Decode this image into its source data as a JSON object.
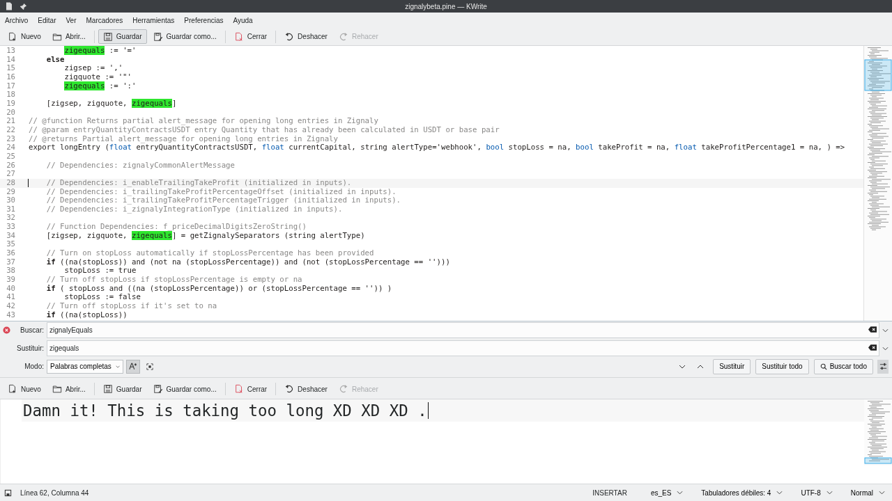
{
  "window": {
    "title": "zignalybeta.pine — KWrite"
  },
  "menu": [
    "Archivo",
    "Editar",
    "Ver",
    "Marcadores",
    "Herramientas",
    "Preferencias",
    "Ayuda"
  ],
  "toolbar": [
    {
      "kind": "new",
      "label": "Nuevo",
      "disabled": false,
      "hovered": false
    },
    {
      "kind": "open",
      "label": "Abrir...",
      "disabled": false,
      "hovered": false
    },
    {
      "kind": "save",
      "label": "Guardar",
      "disabled": false,
      "hovered": true
    },
    {
      "kind": "saveas",
      "label": "Guardar como...",
      "disabled": false,
      "hovered": false
    },
    {
      "kind": "close",
      "label": "Cerrar",
      "disabled": false,
      "hovered": false
    },
    {
      "kind": "undo",
      "label": "Deshacer",
      "disabled": false,
      "hovered": false
    },
    {
      "kind": "redo",
      "label": "Rehacer",
      "disabled": true,
      "hovered": false
    }
  ],
  "editor": {
    "lines": [
      {
        "number": "13",
        "current": false,
        "kind": "nested",
        "segments": [
          {
            "kind": "match",
            "text": "zigequals"
          },
          {
            "kind": "plain",
            "text": " := '='"
          }
        ]
      },
      {
        "number": "14",
        "current": false,
        "kind": "body",
        "segments": [
          {
            "kind": "keyword",
            "text": "else"
          }
        ]
      },
      {
        "number": "15",
        "current": false,
        "kind": "nested",
        "segments": [
          {
            "kind": "plain",
            "text": "zigsep := ','"
          }
        ]
      },
      {
        "number": "16",
        "current": false,
        "kind": "nested",
        "segments": [
          {
            "kind": "plain",
            "text": "zigquote := '\"'"
          }
        ]
      },
      {
        "number": "17",
        "current": false,
        "kind": "nested",
        "segments": [
          {
            "kind": "match",
            "text": "zigequals"
          },
          {
            "kind": "plain",
            "text": " := ':'"
          }
        ]
      },
      {
        "number": "18",
        "current": false,
        "kind": "blank"
      },
      {
        "number": "19",
        "current": false,
        "kind": "body",
        "segments": [
          {
            "kind": "plain",
            "text": "[zigsep, zigquote, "
          },
          {
            "kind": "match",
            "text": "zigequals"
          },
          {
            "kind": "plain",
            "text": "]"
          }
        ]
      },
      {
        "number": "20",
        "current": false,
        "kind": "blank"
      },
      {
        "number": "21",
        "current": false,
        "kind": "top",
        "segments": [
          {
            "kind": "comment",
            "text": "// @function Returns partial alert_message for opening long entries in Zignaly"
          }
        ]
      },
      {
        "number": "22",
        "current": false,
        "kind": "top",
        "segments": [
          {
            "kind": "comment",
            "text": "// @param entryQuantityContractsUSDT entry Quantity that has already been calculated in USDT or base pair"
          }
        ]
      },
      {
        "number": "23",
        "current": false,
        "kind": "top",
        "segments": [
          {
            "kind": "comment",
            "text": "// @returns Partial alert_message for opening long entries in Zignaly"
          }
        ]
      },
      {
        "number": "24",
        "current": false,
        "kind": "top",
        "segments": [
          {
            "kind": "plain",
            "text": "export longEntry ("
          },
          {
            "kind": "type",
            "text": "float"
          },
          {
            "kind": "plain",
            "text": " entryQuantityContractsUSDT, "
          },
          {
            "kind": "type",
            "text": "float"
          },
          {
            "kind": "plain",
            "text": " currentCapital, string alertType='webhook', "
          },
          {
            "kind": "type",
            "text": "bool"
          },
          {
            "kind": "plain",
            "text": " stopLoss = na, "
          },
          {
            "kind": "type",
            "text": "bool"
          },
          {
            "kind": "plain",
            "text": " takeProfit = na, "
          },
          {
            "kind": "type",
            "text": "float"
          },
          {
            "kind": "plain",
            "text": " takeProfitPercentage1 = na, ) =>"
          }
        ]
      },
      {
        "number": "25",
        "current": false,
        "kind": "blank"
      },
      {
        "number": "26",
        "current": false,
        "kind": "body",
        "segments": [
          {
            "kind": "comment",
            "text": "// Dependencies: zignalyCommonAlertMessage"
          }
        ]
      },
      {
        "number": "27",
        "current": false,
        "kind": "blank"
      },
      {
        "number": "28",
        "current": true,
        "kind": "body",
        "segments": [
          {
            "kind": "comment",
            "text": "// Dependencies: i_enableTrailingTakeProfit (initialized in inputs)."
          }
        ]
      },
      {
        "number": "29",
        "current": false,
        "kind": "body",
        "segments": [
          {
            "kind": "comment",
            "text": "// Dependencies: i_trailingTakeProfitPercentageOffset (initialized in inputs)."
          }
        ]
      },
      {
        "number": "30",
        "current": false,
        "kind": "body",
        "segments": [
          {
            "kind": "comment",
            "text": "// Dependencies: i_trailingTakeProfitPercentageTrigger (initialized in inputs)."
          }
        ]
      },
      {
        "number": "31",
        "current": false,
        "kind": "body",
        "segments": [
          {
            "kind": "comment",
            "text": "// Dependencies: i_zignalyIntegrationType (initialized in inputs)."
          }
        ]
      },
      {
        "number": "32",
        "current": false,
        "kind": "blank"
      },
      {
        "number": "33",
        "current": false,
        "kind": "body",
        "segments": [
          {
            "kind": "comment",
            "text": "// Function Dependencies: f_priceDecimalDigitsZeroString()"
          }
        ]
      },
      {
        "number": "34",
        "current": false,
        "kind": "body",
        "segments": [
          {
            "kind": "plain",
            "text": "[zigsep, zigquote, "
          },
          {
            "kind": "match",
            "text": "zigequals"
          },
          {
            "kind": "plain",
            "text": "] = getZignalySeparators (string alertType)"
          }
        ]
      },
      {
        "number": "35",
        "current": false,
        "kind": "blank"
      },
      {
        "number": "36",
        "current": false,
        "kind": "body",
        "segments": [
          {
            "kind": "comment",
            "text": "// Turn on stopLoss automatically if stopLossPercentage has been provided"
          }
        ]
      },
      {
        "number": "37",
        "current": false,
        "kind": "body",
        "segments": [
          {
            "kind": "keyword",
            "text": "if"
          },
          {
            "kind": "plain",
            "text": " ((na(stopLoss)) and (not na (stopLossPercentage)) and (not (stopLossPercentage == '')))"
          }
        ]
      },
      {
        "number": "38",
        "current": false,
        "kind": "nested",
        "segments": [
          {
            "kind": "plain",
            "text": "stopLoss := true"
          }
        ]
      },
      {
        "number": "39",
        "current": false,
        "kind": "body",
        "segments": [
          {
            "kind": "comment",
            "text": "// Turn off stopLoss if stopLossPercentage is empty or na"
          }
        ]
      },
      {
        "number": "40",
        "current": false,
        "kind": "body",
        "segments": [
          {
            "kind": "keyword",
            "text": "if"
          },
          {
            "kind": "plain",
            "text": " ( stopLoss and ((na (stopLossPercentage)) or (stopLossPercentage == '')) )"
          }
        ]
      },
      {
        "number": "41",
        "current": false,
        "kind": "nested",
        "segments": [
          {
            "kind": "plain",
            "text": "stopLoss := false"
          }
        ]
      },
      {
        "number": "42",
        "current": false,
        "kind": "body",
        "segments": [
          {
            "kind": "comment",
            "text": "// Turn off stopLoss if it's set to na"
          }
        ]
      },
      {
        "number": "43",
        "current": false,
        "kind": "body",
        "segments": [
          {
            "kind": "keyword",
            "text": "if"
          },
          {
            "kind": "plain",
            "text": " ((na(stopLoss))"
          }
        ]
      }
    ]
  },
  "search_panel": {
    "search_label": "Buscar:",
    "search_value": "zignalyEquals",
    "replace_label": "Sustituir:",
    "replace_value": "zigequals",
    "mode_label": "Modo:",
    "mode_value": "Palabras completas",
    "options": [
      {
        "kind": "match-case",
        "selected": true
      },
      {
        "kind": "selection-only",
        "selected": false
      }
    ],
    "buttons": [
      "Sustituir",
      "Sustituir todo",
      "Buscar todo"
    ]
  },
  "second_window": {
    "toolbar": [
      {
        "kind": "new",
        "label": "Nuevo",
        "disabled": false,
        "hovered": false
      },
      {
        "kind": "open",
        "label": "Abrir...",
        "disabled": false,
        "hovered": false
      },
      {
        "kind": "save",
        "label": "Guardar",
        "disabled": false,
        "hovered": false
      },
      {
        "kind": "saveas",
        "label": "Guardar como...",
        "disabled": false,
        "hovered": false
      },
      {
        "kind": "close",
        "label": "Cerrar",
        "disabled": false,
        "hovered": false
      },
      {
        "kind": "undo",
        "label": "Deshacer",
        "disabled": false,
        "hovered": false
      },
      {
        "kind": "redo",
        "label": "Rehacer",
        "disabled": true,
        "hovered": false
      }
    ],
    "text": "Damn it! This is taking too long XD XD XD ."
  },
  "status_bar": {
    "position": "Línea 62, Columna 44",
    "mode": "INSERTAR",
    "dropdowns": [
      "es_ES",
      "Tabuladores débiles: 4",
      "UTF-8",
      "Normal"
    ]
  }
}
